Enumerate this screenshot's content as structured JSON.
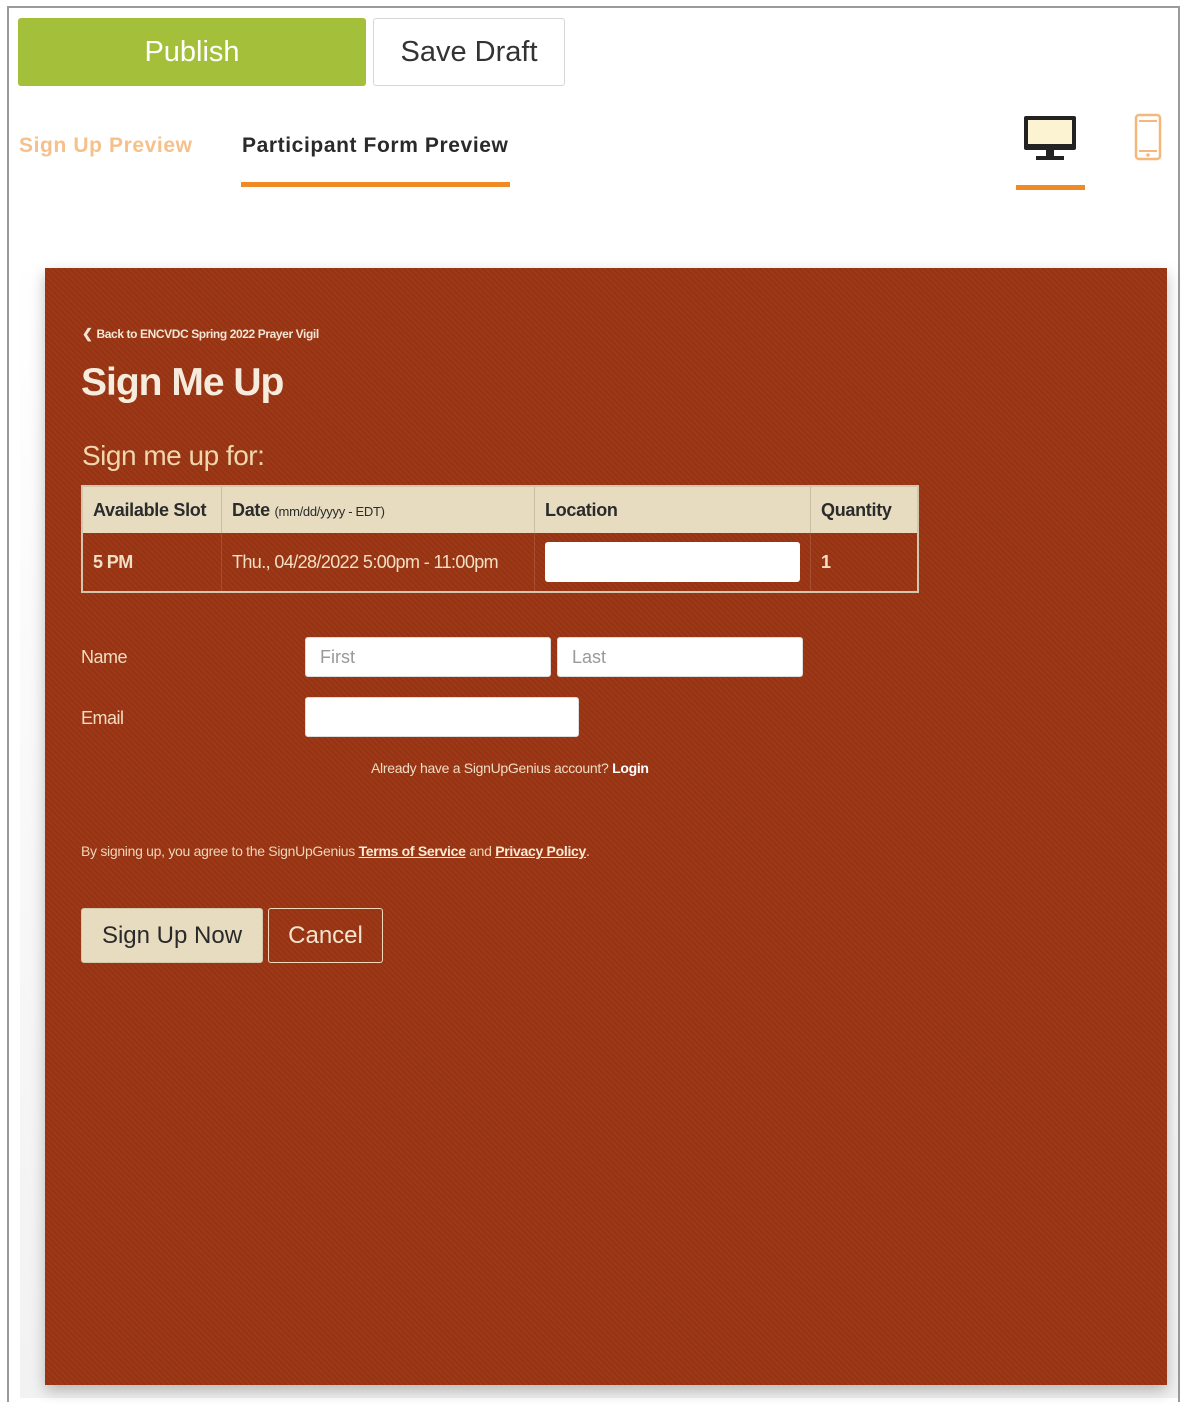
{
  "toolbar": {
    "publish_label": "Publish",
    "save_draft_label": "Save Draft"
  },
  "tabs": [
    {
      "label": "Sign Up Preview",
      "active": false
    },
    {
      "label": "Participant Form Preview",
      "active": true
    }
  ],
  "device_toggle": {
    "options": [
      "desktop-icon",
      "mobile-icon"
    ],
    "active": "desktop-icon"
  },
  "colors": {
    "accent": "#f08a24",
    "publish": "#a4c03a",
    "preview_background": "#9a3412",
    "table_header": "#e8dcc0"
  },
  "form": {
    "back_link": "Back to ENCVDC Spring 2022 Prayer Vigil",
    "title": "Sign Me Up",
    "subtitle": "Sign me up for:",
    "table": {
      "headers": {
        "slot": "Available Slot",
        "date": "Date",
        "date_format": "(mm/dd/yyyy - EDT)",
        "location": "Location",
        "quantity": "Quantity"
      },
      "rows": [
        {
          "slot": "5 PM",
          "date": "Thu., 04/28/2022 5:00pm - 11:00pm",
          "location": "",
          "quantity": "1"
        }
      ]
    },
    "name_label": "Name",
    "first_placeholder": "First",
    "last_placeholder": "Last",
    "email_label": "Email",
    "email_value": "",
    "login_prompt": "Already have a SignUpGenius account?",
    "login_link": "Login",
    "terms_prefix": "By signing up, you agree to the SignUpGenius",
    "terms_link": "Terms of Service",
    "terms_and": "and",
    "privacy_link": "Privacy Policy",
    "terms_suffix": ".",
    "signup_button": "Sign Up Now",
    "cancel_button": "Cancel"
  }
}
